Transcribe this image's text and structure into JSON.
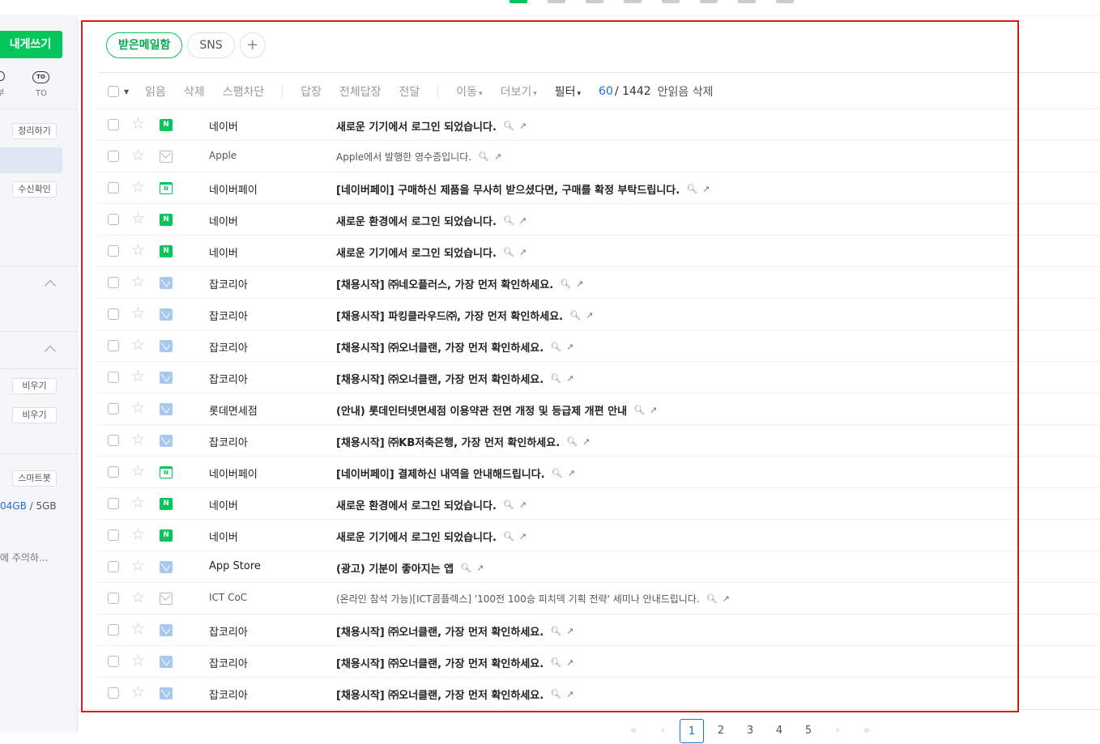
{
  "topbar": {
    "icons": [
      "mail-icon",
      "calendar-icon",
      "contacts-icon",
      "memo-icon",
      "drive-icon",
      "office-icon",
      "blog-icon",
      "favorites-icon"
    ]
  },
  "sidebar": {
    "compose_label": "내게쓰기",
    "icon_left_label": "부",
    "to_badge": "TO",
    "to_label": "TO",
    "organize_label": "정리하기",
    "read_receipt_label": "수신확인",
    "empty1_label": "비우기",
    "empty2_label": "비우기",
    "smartbot_label": "스마트봇",
    "storage_used": "04GB",
    "storage_sep": " / ",
    "storage_total": "5GB",
    "notice": "에 주의하..."
  },
  "tabs": {
    "inbox": "받은메일함",
    "sns": "SNS",
    "add": "+"
  },
  "toolbar": {
    "read": "읽음",
    "delete": "삭제",
    "spam": "스팸차단",
    "reply": "답장",
    "reply_all": "전체답장",
    "forward": "전달",
    "move": "이동",
    "more": "더보기",
    "filter": "필터",
    "count_current": "60",
    "count_total": "/ 1442",
    "delete_unread": "안읽음 삭제"
  },
  "emails": [
    {
      "icon": "naver",
      "sender": "네이버",
      "subject": "새로운 기기에서 로그인 되었습니다.",
      "read": false
    },
    {
      "icon": "open",
      "sender": "Apple",
      "subject": "Apple에서 발행한 영수증입니다.",
      "read": true
    },
    {
      "icon": "pay",
      "sender": "네이버페이",
      "subject": "[네이버페이] 구매하신 제품을 무사히 받으셨다면, 구매를 확정 부탁드립니다.",
      "read": false
    },
    {
      "icon": "naver",
      "sender": "네이버",
      "subject": "새로운 환경에서 로그인 되었습니다.",
      "read": false
    },
    {
      "icon": "naver",
      "sender": "네이버",
      "subject": "새로운 기기에서 로그인 되었습니다.",
      "read": false
    },
    {
      "icon": "mail",
      "sender": "잡코리아",
      "subject": "[채용시작] ㈜네오플러스, 가장 먼저 확인하세요.",
      "read": false
    },
    {
      "icon": "mail",
      "sender": "잡코리아",
      "subject": "[채용시작] 파킹클라우드㈜, 가장 먼저 확인하세요.",
      "read": false
    },
    {
      "icon": "mail",
      "sender": "잡코리아",
      "subject": "[채용시작] ㈜오너클랜, 가장 먼저 확인하세요.",
      "read": false
    },
    {
      "icon": "mail",
      "sender": "잡코리아",
      "subject": "[채용시작] ㈜오너클랜, 가장 먼저 확인하세요.",
      "read": false
    },
    {
      "icon": "mail",
      "sender": "롯데면세점",
      "subject": "(안내) 롯데인터넷면세점 이용약관 전면 개정 및 등급제 개편 안내",
      "read": false
    },
    {
      "icon": "mail",
      "sender": "잡코리아",
      "subject": "[채용시작] ㈜KB저축은행, 가장 먼저 확인하세요.",
      "read": false
    },
    {
      "icon": "pay",
      "sender": "네이버페이",
      "subject": "[네이버페이] 결제하신 내역을 안내해드립니다.",
      "read": false
    },
    {
      "icon": "naver",
      "sender": "네이버",
      "subject": "새로운 환경에서 로그인 되었습니다.",
      "read": false
    },
    {
      "icon": "naver",
      "sender": "네이버",
      "subject": "새로운 기기에서 로그인 되었습니다.",
      "read": false
    },
    {
      "icon": "mail",
      "sender": "App Store",
      "subject": "(광고) 기분이 좋아지는 앱",
      "read": false
    },
    {
      "icon": "open",
      "sender": "ICT CoC",
      "subject": "(온라인 참석 가능)[ICT콤플렉스] '100전 100승 피치덱 기획 전략' 세미나 안내드립니다.",
      "read": true
    },
    {
      "icon": "mail",
      "sender": "잡코리아",
      "subject": "[채용시작] ㈜오너클랜, 가장 먼저 확인하세요.",
      "read": false
    },
    {
      "icon": "mail",
      "sender": "잡코리아",
      "subject": "[채용시작] ㈜오너클랜, 가장 먼저 확인하세요.",
      "read": false
    },
    {
      "icon": "mail",
      "sender": "잡코리아",
      "subject": "[채용시작] ㈜오너클랜, 가장 먼저 확인하세요.",
      "read": false
    }
  ],
  "pager": {
    "first": "«",
    "prev": "‹",
    "pages": [
      "1",
      "2",
      "3",
      "4",
      "5"
    ],
    "current": "1",
    "next": "›",
    "last": "»"
  },
  "colors": {
    "accent": "#03c75a",
    "link": "#1b70d8",
    "highlight": "#d91a1a"
  }
}
